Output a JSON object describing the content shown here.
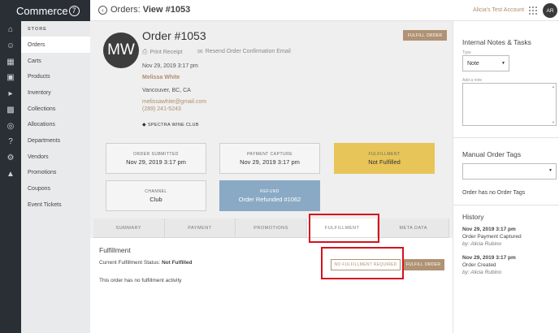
{
  "brand": {
    "name": "Commerce",
    "mark": "7"
  },
  "header": {
    "prefix": "Orders: ",
    "title": "View #1053",
    "account": "Alicia's Test Account",
    "avatar_initials": "AR"
  },
  "nav": {
    "section": "STORE",
    "items": [
      {
        "label": "Orders",
        "active": true
      },
      {
        "label": "Carts"
      },
      {
        "label": "Products"
      },
      {
        "label": "Inventory"
      },
      {
        "label": "Collections"
      },
      {
        "label": "Allocations"
      },
      {
        "label": "Departments"
      },
      {
        "label": "Vendors"
      },
      {
        "label": "Promotions"
      },
      {
        "label": "Coupons"
      },
      {
        "label": "Event Tickets"
      }
    ]
  },
  "rail_icons": [
    "home-icon",
    "user-icon",
    "store-icon",
    "gift-icon",
    "megaphone-icon",
    "chart-icon",
    "settings-icon",
    "help-icon",
    "cog-icon",
    "thumbs-up-icon"
  ],
  "order": {
    "initials": "MW",
    "title": "Order #1053",
    "fulfill_label": "FULFILL ORDER",
    "print_receipt": "Print Receipt",
    "resend": "Resend Order Confirmation Email",
    "date": "Nov 29, 2019 3:17 pm",
    "customer": "Melissa White",
    "location": "Vancouver, BC, CA",
    "email": "melissawhite@gmail.com",
    "phone": "(289) 241-5243",
    "club": "SPECTRA WINE CLUB"
  },
  "cards": {
    "submitted": {
      "label": "ORDER SUBMITTED",
      "value": "Nov 29, 2019 3:17 pm"
    },
    "payment": {
      "label": "PAYMENT CAPTURE",
      "value": "Nov 29, 2019 3:17 pm"
    },
    "fulfillment": {
      "label": "FULFILLMENT",
      "value": "Not Fulfilled"
    },
    "channel": {
      "label": "CHANNEL",
      "value": "Club"
    },
    "refund": {
      "label": "REFUND",
      "value": "Order Refunded #1062"
    }
  },
  "tabs": [
    "SUMMARY",
    "PAYMENT",
    "PROMOTIONS",
    "FULFILLMENT",
    "META DATA"
  ],
  "fulfillment_panel": {
    "title": "Fulfillment",
    "status_label": "Current Fulfillment Status: ",
    "status_value": "Not Fulfilled",
    "no_activity": "This order has no fulfillment activity",
    "no_fulfillment_required": "NO FULFILLMENT REQUIRED",
    "fulfill_order": "FULFILL ORDER"
  },
  "right_panel": {
    "notes_title": "Internal Notes & Tasks",
    "type_label": "Type",
    "type_value": "Note",
    "note_label": "Add a note",
    "tags_title": "Manual Order Tags",
    "no_tags": "Order has no Order Tags",
    "history_title": "History",
    "history": [
      {
        "date": "Nov 29, 2019 3:17 pm",
        "event": "Order Payment Captured",
        "by": "by: Alicia Rubino"
      },
      {
        "date": "Nov 29, 2019 3:17 pm",
        "event": "Order Created",
        "by": "by: Alicia Rubino"
      }
    ]
  }
}
